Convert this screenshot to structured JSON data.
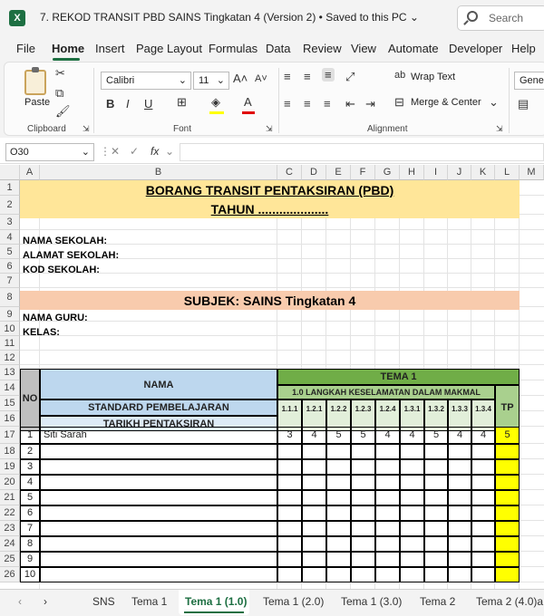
{
  "window": {
    "title": "7. REKOD TRANSIT PBD SAINS Tingkatan 4 (Version 2) • Saved to this PC ⌄",
    "search_placeholder": "Search"
  },
  "menu": [
    "File",
    "Home",
    "Insert",
    "Page Layout",
    "Formulas",
    "Data",
    "Review",
    "View",
    "Automate",
    "Developer",
    "Help"
  ],
  "ribbon": {
    "clipboard_label": "Clipboard",
    "paste_label": "Paste",
    "font_label": "Font",
    "font_name": "Calibri",
    "font_size": "11",
    "alignment_label": "Alignment",
    "wrap_text": "Wrap Text",
    "merge_center": "Merge & Center",
    "number_format": "General"
  },
  "formula_bar": {
    "name_box": "O30",
    "fx": "fx"
  },
  "columns": [
    "A",
    "B",
    "C",
    "D",
    "E",
    "F",
    "G",
    "H",
    "I",
    "J",
    "K",
    "L",
    "M"
  ],
  "rows": [
    "1",
    "2",
    "3",
    "4",
    "5",
    "6",
    "7",
    "8",
    "9",
    "10",
    "11",
    "12",
    "13",
    "14",
    "15",
    "16",
    "17",
    "18",
    "19",
    "20",
    "21",
    "22",
    "23",
    "24",
    "25",
    "26"
  ],
  "sheet": {
    "title1": "BORANG TRANSIT PENTAKSIRAN (PBD)",
    "title2": "TAHUN ....................",
    "nama_sekolah": "NAMA SEKOLAH:",
    "alamat_sekolah": "ALAMAT SEKOLAH:",
    "kod_sekolah": "KOD SEKOLAH:",
    "subjek": "SUBJEK: SAINS Tingkatan 4",
    "nama_guru": "NAMA GURU:",
    "kelas": "KELAS:",
    "no": "NO",
    "nama": "NAMA",
    "tema": "TEMA 1",
    "langkah": "1.0 LANGKAH KESELAMATAN DALAM MAKMAL",
    "standard": "STANDARD PEMBELAJARAN",
    "tarikh": "TARIKH PENTAKSIRAN",
    "tp": "TP",
    "sp_codes": [
      "1.1.1",
      "1.2.1",
      "1.2.2",
      "1.2.3",
      "1.2.4",
      "1.3.1",
      "1.3.2",
      "1.3.3",
      "1.3.4"
    ],
    "students": [
      {
        "no": "1",
        "name": "Siti Sarah",
        "scores": [
          "3",
          "4",
          "5",
          "5",
          "4",
          "4",
          "5",
          "4",
          "4"
        ],
        "tp": "5"
      },
      {
        "no": "2",
        "name": "",
        "scores": [],
        "tp": ""
      },
      {
        "no": "3",
        "name": "",
        "scores": [],
        "tp": ""
      },
      {
        "no": "4",
        "name": "",
        "scores": [],
        "tp": ""
      },
      {
        "no": "5",
        "name": "",
        "scores": [],
        "tp": ""
      },
      {
        "no": "6",
        "name": "",
        "scores": [],
        "tp": ""
      },
      {
        "no": "7",
        "name": "",
        "scores": [],
        "tp": ""
      },
      {
        "no": "8",
        "name": "",
        "scores": [],
        "tp": ""
      },
      {
        "no": "9",
        "name": "",
        "scores": [],
        "tp": ""
      },
      {
        "no": "10",
        "name": "",
        "scores": [],
        "tp": ""
      }
    ]
  },
  "tabs": [
    "SNS",
    "Tema 1",
    "Tema 1 (1.0)",
    "Tema 1 (2.0)",
    "Tema 1 (3.0)",
    "Tema 2",
    "Tema 2 (4.0)a"
  ],
  "colors": {
    "excel_green": "#1d6f42",
    "title_fill": "#ffe699",
    "subject_fill": "#f8cbad",
    "header_blue": "#bdd7ee",
    "header_green": "#70ad47",
    "tema_green": "#a9d08e",
    "tp_yellow": "#ffff00"
  }
}
